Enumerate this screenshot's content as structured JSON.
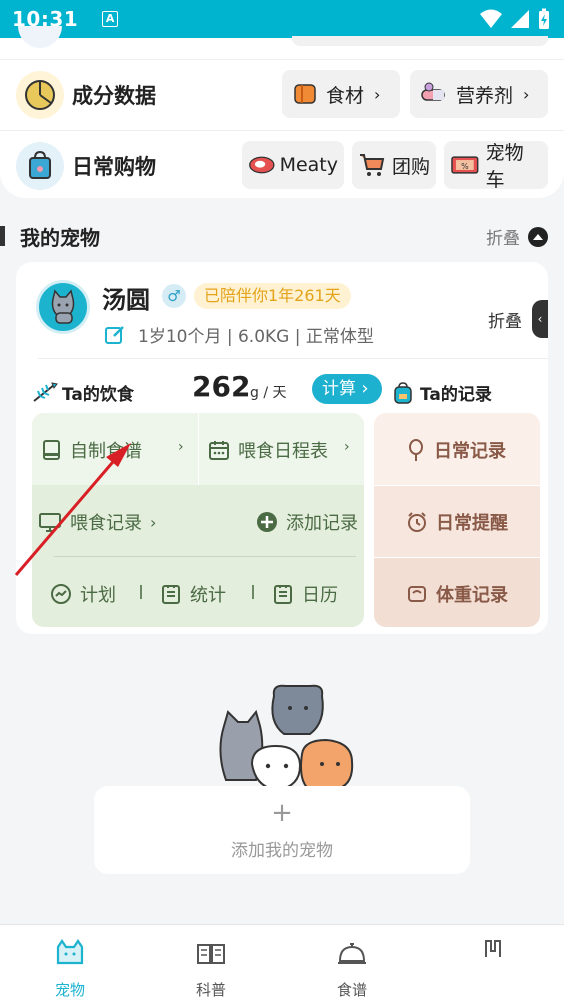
{
  "status_bar": {
    "time": "10:31",
    "app_badge": "A"
  },
  "rows": [
    {
      "title": "成分数据",
      "chips": [
        {
          "label": "食材"
        },
        {
          "label": "营养剂"
        }
      ]
    },
    {
      "title": "日常购物",
      "chips": [
        {
          "label": "Meaty"
        },
        {
          "label": "团购"
        },
        {
          "label": "宠物车"
        }
      ]
    }
  ],
  "my_pets": {
    "title": "我的宠物",
    "fold_label": "折叠"
  },
  "pet": {
    "name": "汤圆",
    "gender": "♂",
    "companion_badge": "已陪伴你1年261天",
    "info": "1岁10个月 | 6.0KG | 正常体型",
    "fold_label": "折叠"
  },
  "diet": {
    "label": "Ta的饮食",
    "calories": "262",
    "unit": "g / 天",
    "calc_label": "计算",
    "records_label": "Ta的记录"
  },
  "diet_grid": {
    "homemade_recipe": "自制食谱",
    "feeding_schedule": "喂食日程表",
    "feeding_record": "喂食记录",
    "add_record": "添加记录",
    "plan": "计划",
    "stats": "统计",
    "calendar": "日历"
  },
  "records": {
    "daily_record": "日常记录",
    "daily_reminder": "日常提醒",
    "weight_record": "体重记录"
  },
  "add_pet": {
    "plus": "+",
    "label": "添加我的宠物"
  },
  "tabs": [
    {
      "label": "宠物",
      "active": true
    },
    {
      "label": "科普",
      "active": false
    },
    {
      "label": "食谱",
      "active": false
    },
    {
      "label": "",
      "active": false
    }
  ],
  "colors": {
    "accent": "#00b3cf",
    "diet_bg": "#e4eedc",
    "record_bg": "#f6e6dd",
    "badge": "#e3a31b"
  }
}
